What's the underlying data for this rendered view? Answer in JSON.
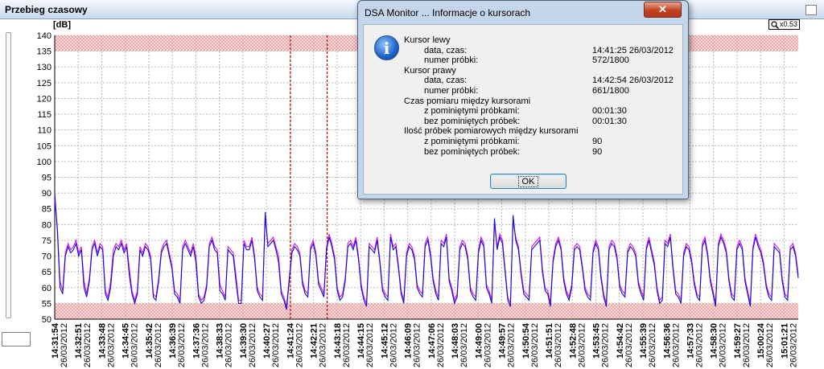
{
  "window": {
    "title": "Przebieg czasowy"
  },
  "zoom": {
    "label": "x0.53"
  },
  "chart_data": {
    "type": "line",
    "ylabel": "[dB]",
    "ylim": [
      50,
      140
    ],
    "yticks": [
      50,
      55,
      60,
      65,
      70,
      75,
      80,
      85,
      90,
      95,
      100,
      105,
      110,
      115,
      120,
      125,
      130,
      135,
      140
    ],
    "shaded_bands": [
      [
        135,
        140
      ],
      [
        50,
        55
      ]
    ],
    "cursors": [
      "14:41:25",
      "14:42:54"
    ],
    "grid": true,
    "xticks": [
      {
        "time": "14:31:54",
        "date": "26/03/2012"
      },
      {
        "time": "14:32:51",
        "date": "26/03/2012"
      },
      {
        "time": "14:33:48",
        "date": "26/03/2012"
      },
      {
        "time": "14:34:45",
        "date": "26/03/2012"
      },
      {
        "time": "14:35:42",
        "date": "26/03/2012"
      },
      {
        "time": "14:36:39",
        "date": "26/03/2012"
      },
      {
        "time": "14:37:36",
        "date": "26/03/2012"
      },
      {
        "time": "14:38:33",
        "date": "26/03/2012"
      },
      {
        "time": "14:39:30",
        "date": "26/03/2012"
      },
      {
        "time": "14:40:27",
        "date": "26/03/2012"
      },
      {
        "time": "14:41:24",
        "date": "26/03/2012"
      },
      {
        "time": "14:42:21",
        "date": "26/03/2012"
      },
      {
        "time": "14:43:18",
        "date": "26/03/2012"
      },
      {
        "time": "14:44:15",
        "date": "26/03/2012"
      },
      {
        "time": "14:45:12",
        "date": "26/03/2012"
      },
      {
        "time": "14:46:09",
        "date": "26/03/2012"
      },
      {
        "time": "14:47:06",
        "date": "26/03/2012"
      },
      {
        "time": "14:48:03",
        "date": "26/03/2012"
      },
      {
        "time": "14:49:00",
        "date": "26/03/2012"
      },
      {
        "time": "14:49:57",
        "date": "26/03/2012"
      },
      {
        "time": "14:50:54",
        "date": "26/03/2012"
      },
      {
        "time": "14:51:51",
        "date": "26/03/2012"
      },
      {
        "time": "14:52:48",
        "date": "26/03/2012"
      },
      {
        "time": "14:53:45",
        "date": "26/03/2012"
      },
      {
        "time": "14:54:42",
        "date": "26/03/2012"
      },
      {
        "time": "14:55:39",
        "date": "26/03/2012"
      },
      {
        "time": "14:56:36",
        "date": "26/03/2012"
      },
      {
        "time": "14:57:33",
        "date": "26/03/2012"
      },
      {
        "time": "14:58:30",
        "date": "26/03/2012"
      },
      {
        "time": "14:59:27",
        "date": "26/03/2012"
      },
      {
        "time": "15:00:24",
        "date": "26/03/2012"
      },
      {
        "time": "15:01:21",
        "date": "26/03/2012"
      }
    ],
    "series": [
      {
        "color": "#1010d0",
        "values": [
          90,
          78,
          60,
          58,
          70,
          73,
          71,
          72,
          74,
          70,
          72,
          60,
          57,
          62,
          72,
          74,
          70,
          73,
          72,
          58,
          56,
          60,
          70,
          73,
          72,
          74,
          71,
          73,
          64,
          58,
          55,
          58,
          72,
          70,
          73,
          72,
          69,
          57,
          56,
          62,
          71,
          73,
          74,
          70,
          66,
          58,
          57,
          55,
          72,
          74,
          72,
          70,
          73,
          68,
          57,
          55,
          56,
          60,
          73,
          75,
          72,
          71,
          59,
          58,
          56,
          72,
          71,
          70,
          62,
          55,
          55,
          74,
          72,
          72,
          75,
          69,
          59,
          57,
          56,
          84,
          73,
          74,
          75,
          72,
          68,
          58,
          56,
          53,
          62,
          71,
          73,
          72,
          70,
          61,
          58,
          57,
          72,
          74,
          70,
          61,
          59,
          57,
          72,
          76,
          73,
          69,
          59,
          56,
          57,
          62,
          73,
          74,
          72,
          75,
          69,
          60,
          56,
          54,
          73,
          72,
          71,
          75,
          68,
          59,
          57,
          56,
          76,
          72,
          73,
          66,
          58,
          55,
          70,
          73,
          72,
          69,
          60,
          58,
          57,
          73,
          75,
          70,
          62,
          58,
          56,
          74,
          73,
          76,
          62,
          59,
          55,
          57,
          72,
          74,
          73,
          69,
          59,
          57,
          56,
          71,
          75,
          73,
          60,
          58,
          55,
          82,
          72,
          76,
          74,
          65,
          56,
          54,
          83,
          75,
          72,
          64,
          58,
          57,
          56,
          72,
          73,
          74,
          75,
          65,
          59,
          58,
          54,
          68,
          73,
          75,
          72,
          62,
          58,
          56,
          60,
          72,
          73,
          72,
          66,
          59,
          57,
          56,
          71,
          74,
          72,
          63,
          57,
          54,
          72,
          74,
          73,
          69,
          60,
          58,
          57,
          71,
          73,
          72,
          70,
          61,
          58,
          56,
          72,
          75,
          71,
          67,
          59,
          55,
          56,
          74,
          73,
          76,
          66,
          58,
          57,
          55,
          70,
          73,
          72,
          68,
          61,
          57,
          56,
          73,
          75,
          70,
          62,
          58,
          54,
          73,
          76,
          74,
          71,
          62,
          57,
          56,
          72,
          74,
          72,
          62,
          58,
          54,
          72,
          76,
          73,
          71,
          67,
          60,
          57,
          56,
          73,
          72,
          71,
          62,
          57,
          56,
          72,
          73,
          70,
          63
        ]
      },
      {
        "color": "#e010e0",
        "values": [
          88,
          79,
          62,
          59,
          71,
          74,
          72,
          73,
          75,
          71,
          73,
          62,
          58,
          63,
          73,
          75,
          71,
          74,
          73,
          59,
          57,
          62,
          72,
          74,
          73,
          75,
          72,
          74,
          66,
          59,
          56,
          59,
          73,
          71,
          74,
          73,
          70,
          58,
          57,
          63,
          72,
          74,
          75,
          71,
          67,
          59,
          58,
          56,
          73,
          75,
          73,
          71,
          74,
          70,
          58,
          56,
          57,
          61,
          74,
          76,
          73,
          72,
          61,
          59,
          57,
          73,
          72,
          71,
          64,
          56,
          56,
          75,
          73,
          73,
          76,
          70,
          60,
          58,
          57,
          82,
          74,
          75,
          76,
          73,
          70,
          59,
          57,
          54,
          63,
          72,
          74,
          73,
          71,
          62,
          59,
          58,
          73,
          75,
          71,
          62,
          60,
          58,
          73,
          77,
          74,
          70,
          60,
          57,
          58,
          63,
          74,
          75,
          73,
          76,
          70,
          61,
          57,
          55,
          74,
          73,
          72,
          76,
          69,
          60,
          58,
          57,
          77,
          73,
          74,
          67,
          59,
          56,
          71,
          74,
          73,
          70,
          61,
          59,
          58,
          74,
          76,
          71,
          63,
          59,
          57,
          75,
          74,
          77,
          63,
          60,
          56,
          58,
          73,
          75,
          74,
          70,
          60,
          58,
          57,
          72,
          76,
          74,
          61,
          59,
          56,
          80,
          73,
          77,
          75,
          66,
          57,
          55,
          81,
          76,
          73,
          65,
          59,
          58,
          57,
          73,
          74,
          75,
          76,
          66,
          60,
          59,
          55,
          69,
          74,
          76,
          73,
          63,
          59,
          57,
          61,
          73,
          74,
          73,
          67,
          60,
          58,
          57,
          72,
          75,
          73,
          64,
          58,
          55,
          73,
          75,
          74,
          70,
          61,
          59,
          58,
          72,
          74,
          73,
          71,
          62,
          59,
          57,
          73,
          76,
          72,
          68,
          60,
          56,
          57,
          75,
          74,
          77,
          67,
          59,
          58,
          56,
          71,
          74,
          73,
          69,
          62,
          58,
          57,
          74,
          76,
          71,
          63,
          59,
          55,
          74,
          77,
          75,
          72,
          63,
          58,
          57,
          73,
          75,
          73,
          63,
          59,
          55,
          73,
          77,
          74,
          72,
          68,
          61,
          58,
          57,
          74,
          73,
          72,
          63,
          58,
          57,
          73,
          74,
          71,
          64
        ]
      }
    ]
  },
  "dialog": {
    "title": "DSA Monitor ... Informacje o kursorach",
    "close_glyph": "✕",
    "icon_glyph": "i",
    "ok_label": "OK",
    "rows": [
      {
        "label": "Kursor lewy",
        "value": ""
      },
      {
        "label": "data, czas:",
        "value": "14:41:25 26/03/2012"
      },
      {
        "label": "numer próbki:",
        "value": "572/1800"
      },
      {
        "label": "Kursor prawy",
        "value": ""
      },
      {
        "label": "data, czas:",
        "value": "14:42:54 26/03/2012"
      },
      {
        "label": "numer próbki:",
        "value": "661/1800"
      },
      {
        "label": "Czas pomiaru między kursorami",
        "value": ""
      },
      {
        "label": "z pominiętymi próbkami:",
        "value": "00:01:30"
      },
      {
        "label": "bez pominiętych próbek:",
        "value": "00:01:30"
      },
      {
        "label": "Ilość próbek pomiarowych między kursorami",
        "value": ""
      },
      {
        "label": "z pominiętymi próbkami:",
        "value": "90"
      },
      {
        "label": "bez pominiętych próbek:",
        "value": "90"
      }
    ]
  }
}
